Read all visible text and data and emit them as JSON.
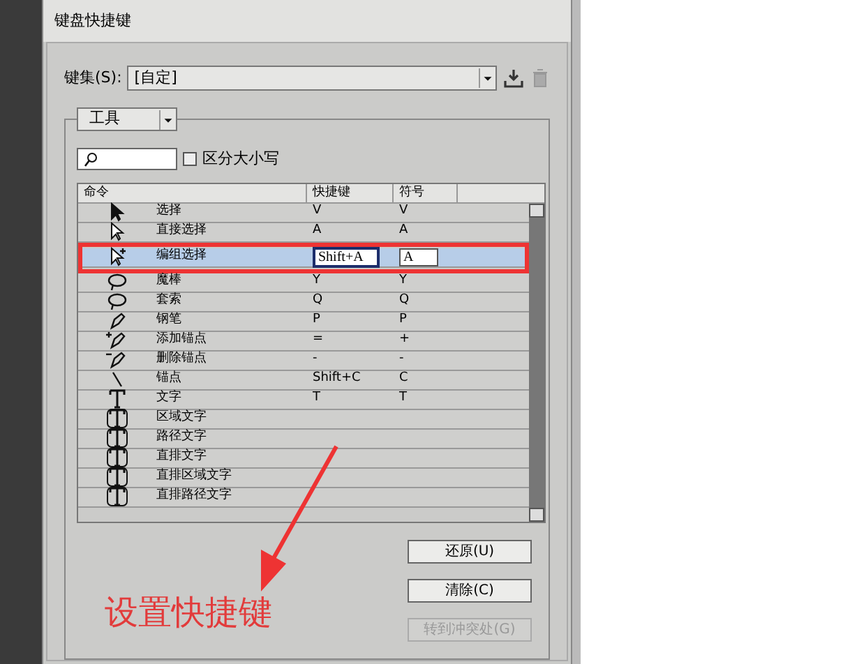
{
  "window": {
    "title": "键盘快捷键"
  },
  "keyset": {
    "label": "键集(S):",
    "value": "[自定]"
  },
  "category": {
    "value": "工具"
  },
  "search": {
    "case_sensitive": {
      "label": "区分大小写",
      "checked": false
    }
  },
  "table": {
    "columns": [
      "命令",
      "快捷键",
      "符号"
    ],
    "rows": [
      {
        "command": "选择",
        "shortcut": "V",
        "symbol": "V",
        "selected": false
      },
      {
        "command": "直接选择",
        "shortcut": "A",
        "symbol": "A",
        "selected": false
      },
      {
        "command": "编组选择",
        "shortcut": "Shift+A",
        "symbol": "A",
        "selected": true
      },
      {
        "command": "魔棒",
        "shortcut": "Y",
        "symbol": "Y",
        "selected": false
      },
      {
        "command": "套索",
        "shortcut": "Q",
        "symbol": "Q",
        "selected": false
      },
      {
        "command": "钢笔",
        "shortcut": "P",
        "symbol": "P",
        "selected": false
      },
      {
        "command": "添加锚点",
        "shortcut": "=",
        "symbol": "+",
        "selected": false
      },
      {
        "command": "删除锚点",
        "shortcut": "-",
        "symbol": "-",
        "selected": false
      },
      {
        "command": "锚点",
        "shortcut": "Shift+C",
        "symbol": "C",
        "selected": false
      },
      {
        "command": "文字",
        "shortcut": "T",
        "symbol": "T",
        "selected": false
      },
      {
        "command": "区域文字",
        "selected": false
      },
      {
        "command": "路径文字",
        "selected": false
      },
      {
        "command": "直排文字",
        "selected": false
      },
      {
        "command": "直排区域文字",
        "selected": false
      },
      {
        "command": "直排路径文字",
        "selected": false
      }
    ]
  },
  "buttons": [
    {
      "label": "还原(U)",
      "disabled": false
    },
    {
      "label": "清除(C)",
      "disabled": false
    },
    {
      "label": "转到冲突处(G)",
      "disabled": true
    }
  ],
  "annotation": {
    "text": "设置快捷键"
  }
}
